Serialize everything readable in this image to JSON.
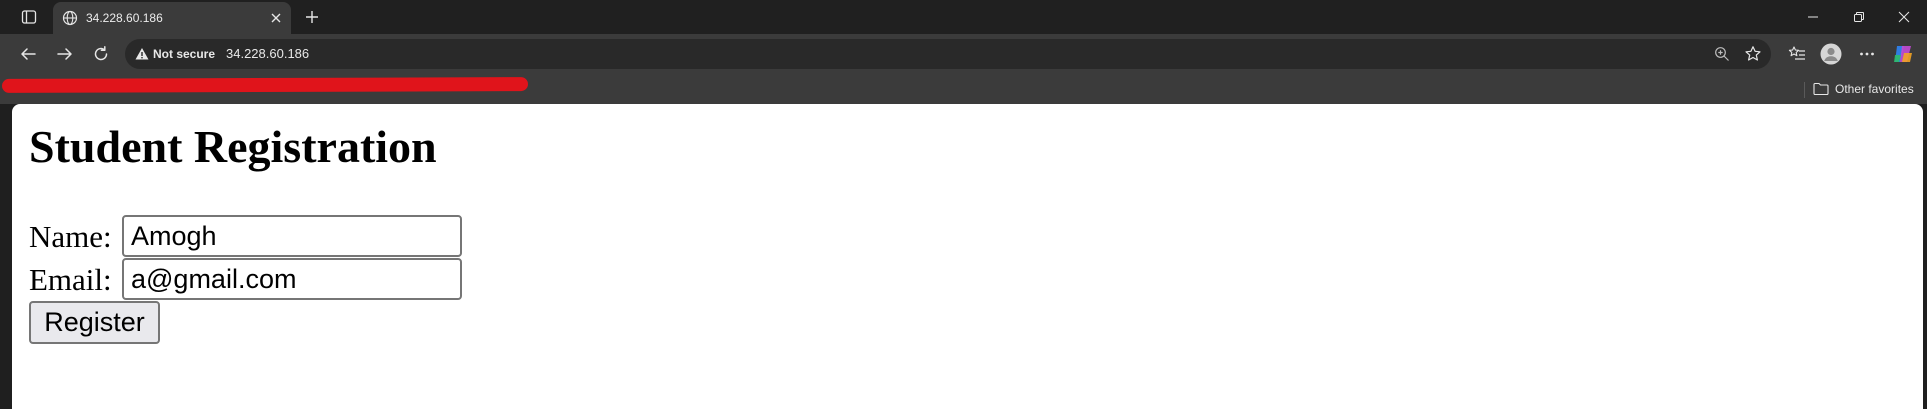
{
  "browser": {
    "tab": {
      "title": "34.228.60.186"
    },
    "address_bar": {
      "security_label": "Not secure",
      "url": "34.228.60.186"
    },
    "favorites_bar": {
      "other_favorites_label": "Other favorites"
    },
    "accent_colors": {
      "redaction_mark": "#e0141b",
      "chrome_dark": "#202020",
      "toolbar": "#3b3b3b"
    }
  },
  "page": {
    "heading": "Student Registration",
    "form": {
      "name_label": "Name:",
      "name_value": "Amogh",
      "email_label": "Email:",
      "email_value": "a@gmail.com",
      "submit_label": "Register"
    }
  }
}
